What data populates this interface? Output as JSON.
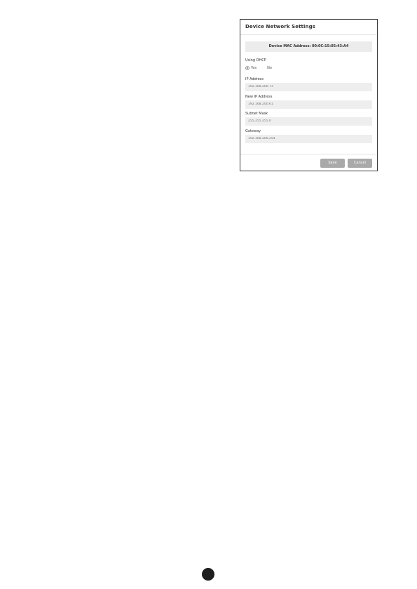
{
  "dialog": {
    "title": "Device Network Settings",
    "mac_address_label": "Device MAC Address: 00:0C:15:05:43:A4",
    "dhcp": {
      "label": "Using DHCP",
      "options": [
        "Yes",
        "No"
      ],
      "selected": "Yes"
    },
    "fields": [
      {
        "label": "IP Address",
        "placeholder": "192.168.200.73"
      },
      {
        "label": "New IP Address",
        "placeholder": "192.168.200.61"
      },
      {
        "label": "Subnet Mask",
        "placeholder": "255.255.255.0"
      },
      {
        "label": "Gateway",
        "placeholder": "192.168.200.254"
      }
    ],
    "buttons": {
      "save": "Save",
      "cancel": "Cancel"
    }
  },
  "colors": {
    "button_gray": "#a9a9a9",
    "field_bg": "#eeeeee",
    "border": "#3a3a3a"
  }
}
